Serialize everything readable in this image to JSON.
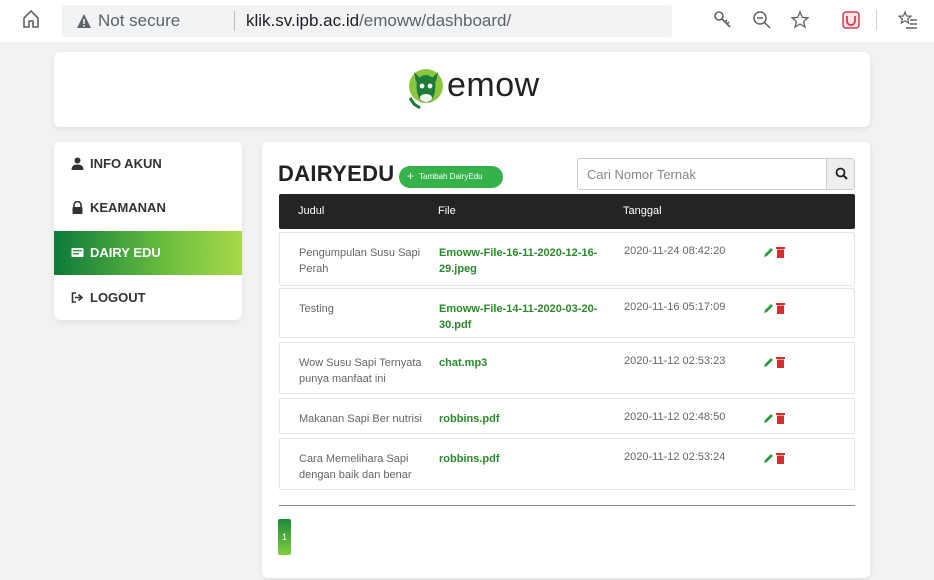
{
  "browser": {
    "security_label": "Not secure",
    "url_domain": "klik.sv.ipb.ac.id",
    "url_path": "/emoww/dashboard/"
  },
  "header": {
    "logo_text": "emow"
  },
  "sidebar": {
    "items": [
      {
        "label": "INFO AKUN",
        "icon": "user-icon"
      },
      {
        "label": "KEAMANAN",
        "icon": "lock-icon"
      },
      {
        "label": "DAIRY EDU",
        "icon": "card-icon",
        "active": true
      },
      {
        "label": "LOGOUT",
        "icon": "sign-out-icon"
      }
    ]
  },
  "main": {
    "title": "DAIRYEDU",
    "add_button_label": "Tambah DairyEdu",
    "search_placeholder": "Cari Nomor Ternak",
    "columns": [
      "Judul",
      "File",
      "Tanggal"
    ],
    "rows": [
      {
        "judul": "Pengumpulan Susu Sapi Perah",
        "file": "Emoww-File-16-11-2020-12-16-29.jpeg",
        "tanggal": "2020-11-24 08:42:20"
      },
      {
        "judul": "Testing",
        "file": "Emoww-File-14-11-2020-03-20-30.pdf",
        "tanggal": "2020-11-16 05:17:09"
      },
      {
        "judul": "Wow Susu Sapi Ternyata punya manfaat ini",
        "file": "chat.mp3",
        "tanggal": "2020-11-12 02:53:23"
      },
      {
        "judul": "Makanan Sapi Ber nutrisi",
        "file": "robbins.pdf",
        "tanggal": "2020-11-12 02:48:50"
      },
      {
        "judul": "Cara Memelihara Sapi dengan baik dan benar",
        "file": "robbins.pdf",
        "tanggal": "2020-11-12 02:53:24"
      }
    ],
    "pagination": {
      "current_page": "1"
    }
  },
  "colors": {
    "accent_green": "#35b34a",
    "file_link": "#2a8a2a",
    "delete_red": "#d32f2f",
    "table_header": "#242424"
  }
}
